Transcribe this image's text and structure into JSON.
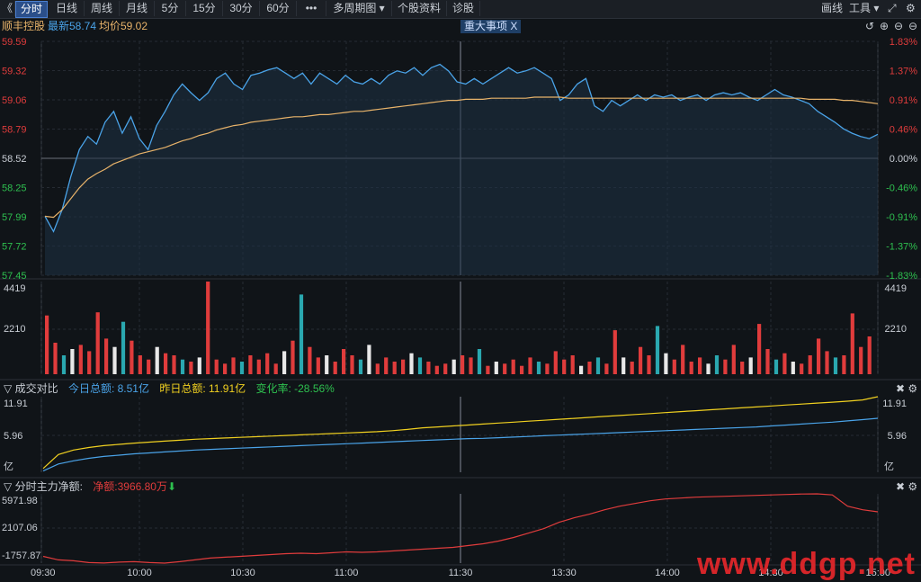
{
  "toolbar": {
    "collapse_icon": "《",
    "tabs": [
      {
        "label": "分时",
        "active": true
      },
      {
        "label": "日线"
      },
      {
        "label": "周线"
      },
      {
        "label": "月线"
      },
      {
        "label": "5分"
      },
      {
        "label": "15分"
      },
      {
        "label": "30分"
      },
      {
        "label": "60分"
      },
      {
        "label": "•••"
      },
      {
        "label": "多周期图 ▾"
      },
      {
        "label": "个股资料"
      },
      {
        "label": "诊股"
      }
    ],
    "draw_label": "画线",
    "tools_label": "工具 ▾",
    "expand_icon": "⤢",
    "settings_icon": "⚙"
  },
  "info": {
    "stock_name": "顺丰控股",
    "latest": "最新58.74",
    "avg": "均价59.02",
    "event_tag": "重大事项",
    "event_close": "X",
    "controls": [
      "↺",
      "⊕",
      "⊖",
      "⊖"
    ]
  },
  "colors": {
    "up": "#e03c3c",
    "down": "#2ec04f",
    "price": "#4aa3e8",
    "avg": "#e8b36a",
    "yellow": "#f0d020",
    "neutral": "#c8cdd4"
  },
  "price_axis": {
    "left": [
      "59.59",
      "59.32",
      "59.06",
      "58.79",
      "58.52",
      "58.25",
      "57.99",
      "57.72",
      "57.45"
    ],
    "right": [
      "1.83%",
      "1.37%",
      "0.91%",
      "0.46%",
      "0.00%",
      "-0.46%",
      "-0.91%",
      "-1.37%",
      "-1.83%"
    ],
    "base": 58.52,
    "max": 59.59,
    "min": 57.45
  },
  "volume_axis": {
    "top": "4419",
    "mid": "2210",
    "max": 4419
  },
  "turnover": {
    "title": "成交对比",
    "today": "今日总额: 8.51亿",
    "yesterday": "昨日总额: 11.91亿",
    "change": "变化率: -28.56%",
    "axis": [
      "11.91",
      "5.96",
      "亿"
    ],
    "max": 11.91
  },
  "mainflow": {
    "title": "分时主力净额:",
    "value": "净额:3966.80万",
    "arrow": "⬇",
    "axis": [
      "5971.98",
      "2107.06",
      "-1757.87"
    ],
    "max": 5971.98,
    "min": -1757.87
  },
  "time_axis": [
    "09:30",
    "10:00",
    "10:30",
    "11:00",
    "11:30",
    "13:30",
    "14:00",
    "14:30",
    "15:00"
  ],
  "watermark": "www.ddgp.net",
  "chart_data": [
    {
      "type": "line",
      "series": [
        {
          "name": "最新",
          "values": [
            57.99,
            57.85,
            58.05,
            58.35,
            58.6,
            58.72,
            58.65,
            58.85,
            58.95,
            58.75,
            58.9,
            58.7,
            58.6,
            58.82,
            58.95,
            59.1,
            59.2,
            59.12,
            59.05,
            59.12,
            59.25,
            59.3,
            59.2,
            59.15,
            59.28,
            59.3,
            59.33,
            59.35,
            59.3,
            59.25,
            59.3,
            59.2,
            59.3,
            59.25,
            59.2,
            59.28,
            59.22,
            59.2,
            59.25,
            59.2,
            59.28,
            59.32,
            59.3,
            59.35,
            59.28,
            59.35,
            59.38,
            59.32,
            59.22,
            59.2,
            59.25,
            59.2,
            59.25,
            59.3,
            59.35,
            59.3,
            59.32,
            59.35,
            59.3,
            59.25,
            59.05,
            59.1,
            59.2,
            59.25,
            59.0,
            58.95,
            59.05,
            59.0,
            59.05,
            59.1,
            59.05,
            59.1,
            59.08,
            59.1,
            59.05,
            59.08,
            59.1,
            59.05,
            59.1,
            59.12,
            59.1,
            59.12,
            59.08,
            59.05,
            59.1,
            59.15,
            59.1,
            59.08,
            59.05,
            59.02,
            58.95,
            58.9,
            58.85,
            58.79,
            58.75,
            58.72,
            58.7,
            58.74
          ]
        },
        {
          "name": "均价",
          "values": [
            57.99,
            57.98,
            58.05,
            58.15,
            58.25,
            58.33,
            58.38,
            58.42,
            58.47,
            58.5,
            58.53,
            58.56,
            58.58,
            58.6,
            58.62,
            58.65,
            58.68,
            58.7,
            58.73,
            58.75,
            58.78,
            58.8,
            58.82,
            58.83,
            58.85,
            58.86,
            58.87,
            58.88,
            58.89,
            58.9,
            58.9,
            58.91,
            58.92,
            58.92,
            58.93,
            58.94,
            58.95,
            58.95,
            58.96,
            58.97,
            58.98,
            58.99,
            59.0,
            59.01,
            59.02,
            59.03,
            59.04,
            59.05,
            59.05,
            59.06,
            59.06,
            59.06,
            59.07,
            59.07,
            59.07,
            59.07,
            59.07,
            59.08,
            59.08,
            59.08,
            59.08,
            59.07,
            59.07,
            59.07,
            59.07,
            59.07,
            59.07,
            59.07,
            59.07,
            59.07,
            59.07,
            59.07,
            59.07,
            59.07,
            59.07,
            59.07,
            59.07,
            59.07,
            59.07,
            59.07,
            59.07,
            59.07,
            59.07,
            59.07,
            59.07,
            59.07,
            59.07,
            59.07,
            59.07,
            59.06,
            59.06,
            59.06,
            59.06,
            59.05,
            59.05,
            59.04,
            59.03,
            59.02
          ]
        }
      ],
      "ylim": [
        57.45,
        59.59
      ]
    },
    {
      "type": "bar",
      "name": "volume",
      "values": [
        2800,
        1500,
        900,
        1200,
        1400,
        1100,
        2950,
        1700,
        1300,
        2500,
        1600,
        900,
        700,
        1300,
        1000,
        900,
        700,
        600,
        800,
        4419,
        700,
        500,
        800,
        600,
        900,
        700,
        1000,
        500,
        1100,
        1600,
        3800,
        1300,
        800,
        900,
        600,
        1200,
        900,
        700,
        1400,
        500,
        800,
        600,
        700,
        1000,
        800,
        600,
        400,
        500,
        700,
        900,
        800,
        1200,
        400,
        600,
        500,
        700,
        400,
        800,
        600,
        500,
        1100,
        700,
        900,
        400,
        600,
        800,
        500,
        2100,
        800,
        600,
        1300,
        900,
        2300,
        1000,
        700,
        1400,
        600,
        800,
        500,
        900,
        700,
        1400,
        600,
        800,
        2400,
        1200,
        700,
        1000,
        600,
        500,
        900,
        1700,
        1100,
        800,
        900,
        2900,
        1300,
        1800
      ],
      "ylim": [
        0,
        4419
      ]
    },
    {
      "type": "line",
      "series": [
        {
          "name": "今日总额",
          "values": [
            0.2,
            1.3,
            1.8,
            2.2,
            2.5,
            2.7,
            2.9,
            3.05,
            3.2,
            3.35,
            3.5,
            3.6,
            3.7,
            3.8,
            3.9,
            4.0,
            4.1,
            4.2,
            4.3,
            4.4,
            4.5,
            4.6,
            4.7,
            4.8,
            4.9,
            5.0,
            5.1,
            5.2,
            5.3,
            5.35,
            5.45,
            5.55,
            5.65,
            5.75,
            5.85,
            5.95,
            6.05,
            6.15,
            6.25,
            6.35,
            6.45,
            6.55,
            6.65,
            6.75,
            6.85,
            6.95,
            7.05,
            7.15,
            7.3,
            7.45,
            7.6,
            7.75,
            7.9,
            8.1,
            8.3,
            8.51
          ]
        },
        {
          "name": "昨日总额",
          "values": [
            0.6,
            2.8,
            3.5,
            3.9,
            4.2,
            4.4,
            4.6,
            4.75,
            4.9,
            5.05,
            5.2,
            5.3,
            5.4,
            5.5,
            5.6,
            5.7,
            5.8,
            5.9,
            6.0,
            6.1,
            6.2,
            6.3,
            6.4,
            6.55,
            6.75,
            7.0,
            7.15,
            7.3,
            7.45,
            7.6,
            7.75,
            7.9,
            8.05,
            8.2,
            8.35,
            8.5,
            8.65,
            8.8,
            8.95,
            9.1,
            9.25,
            9.4,
            9.55,
            9.7,
            9.85,
            10.0,
            10.15,
            10.3,
            10.45,
            10.6,
            10.75,
            10.9,
            11.05,
            11.2,
            11.4,
            11.91
          ]
        }
      ],
      "ylim": [
        0,
        11.91
      ]
    },
    {
      "type": "line",
      "series": [
        {
          "name": "净额",
          "values": [
            -1000,
            -1400,
            -1500,
            -1700,
            -1750,
            -1650,
            -1600,
            -1700,
            -1757,
            -1600,
            -1400,
            -1200,
            -1100,
            -1000,
            -900,
            -800,
            -700,
            -650,
            -700,
            -600,
            -500,
            -550,
            -500,
            -400,
            -300,
            -200,
            -100,
            0,
            200,
            400,
            700,
            1100,
            1600,
            2100,
            2800,
            3300,
            3700,
            4200,
            4600,
            4900,
            5200,
            5400,
            5500,
            5600,
            5650,
            5700,
            5750,
            5800,
            5850,
            5900,
            5950,
            5971,
            5850,
            4600,
            4200,
            3966
          ]
        }
      ],
      "ylim": [
        -1757.87,
        5971.98
      ]
    }
  ]
}
